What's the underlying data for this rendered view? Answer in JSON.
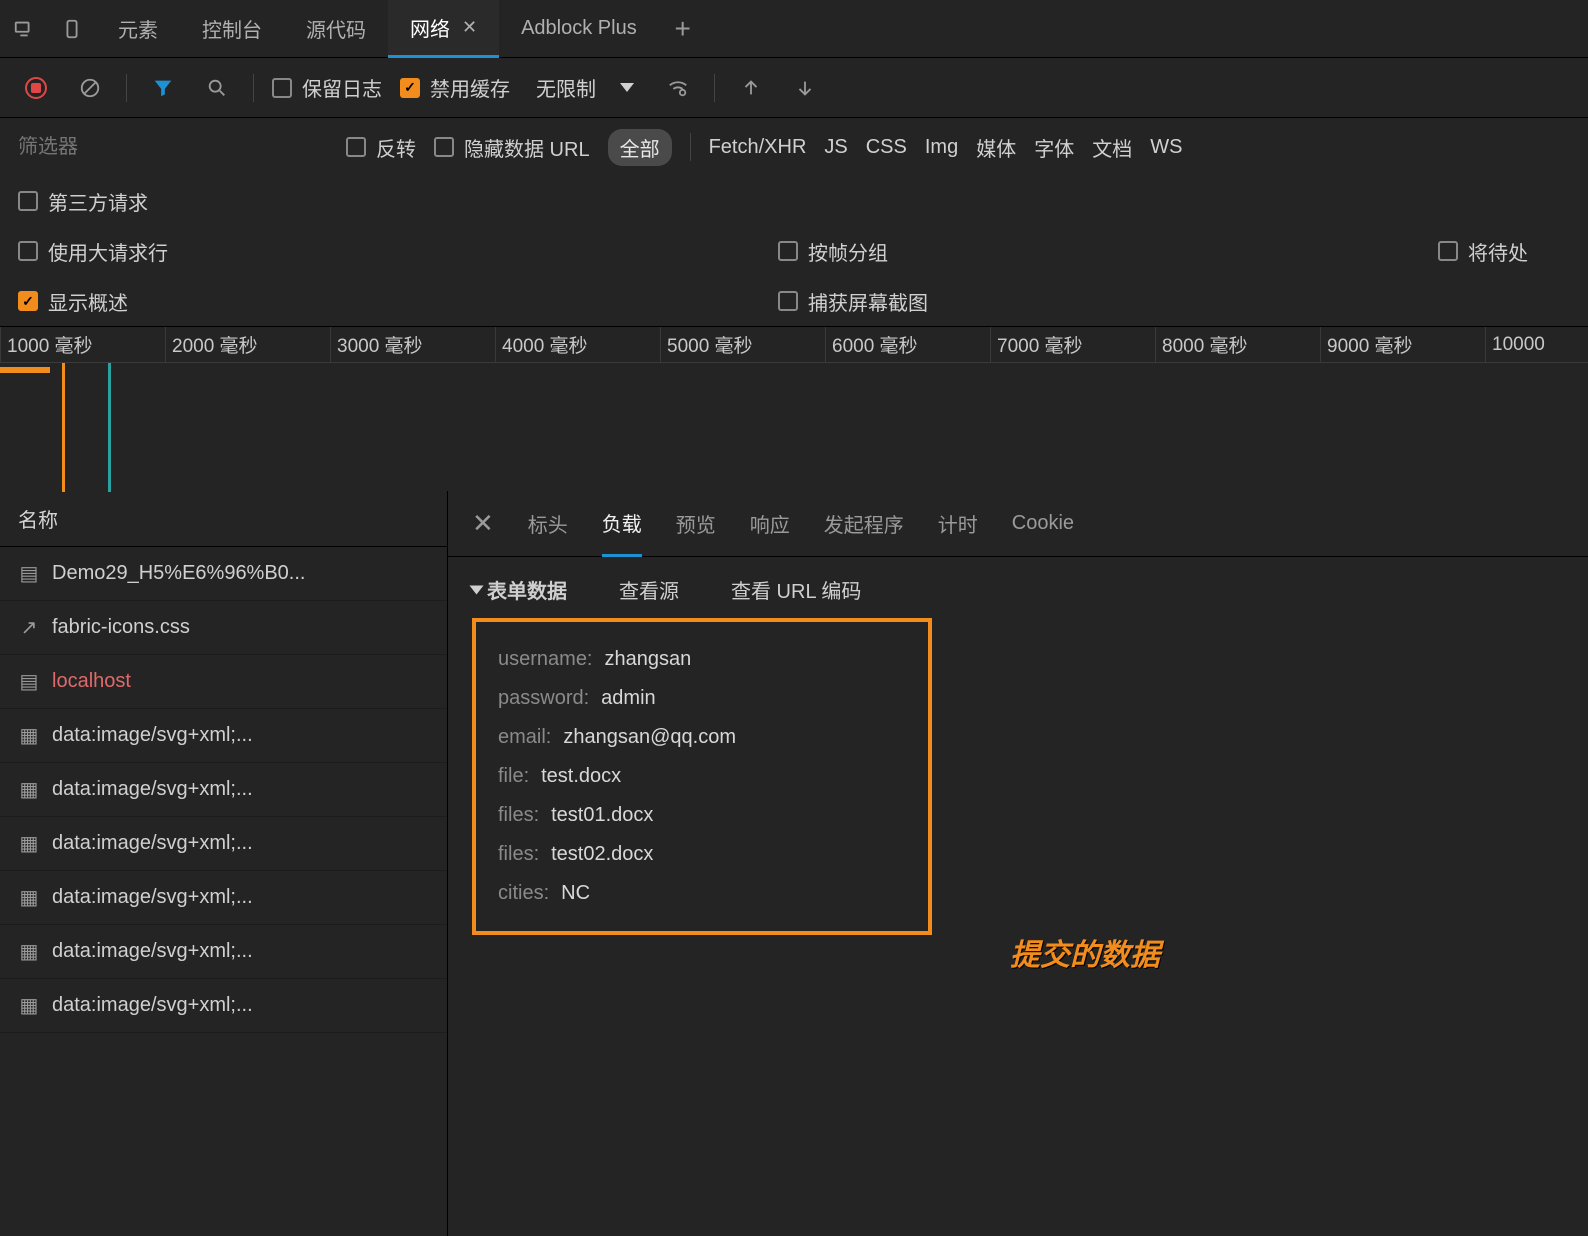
{
  "top_tabs": {
    "elements": "元素",
    "console": "控制台",
    "sources": "源代码",
    "network": "网络",
    "adblock": "Adblock Plus"
  },
  "toolbar": {
    "preserve_log": "保留日志",
    "disable_cache": "禁用缓存",
    "throttling": "无限制"
  },
  "filter": {
    "placeholder": "筛选器",
    "invert": "反转",
    "hide_data_url": "隐藏数据 URL",
    "all": "全部",
    "types": [
      "Fetch/XHR",
      "JS",
      "CSS",
      "Img",
      "媒体",
      "字体",
      "文档",
      "WS"
    ]
  },
  "options": {
    "third_party": "第三方请求",
    "large_rows": "使用大请求行",
    "group_by_frame": "按帧分组",
    "pending": "将待处",
    "show_overview": "显示概述",
    "screenshots": "捕获屏幕截图"
  },
  "timeline": {
    "ticks": [
      "1000 毫秒",
      "2000 毫秒",
      "3000 毫秒",
      "4000 毫秒",
      "5000 毫秒",
      "6000 毫秒",
      "7000 毫秒",
      "8000 毫秒",
      "9000 毫秒",
      "10000"
    ]
  },
  "requests": {
    "header": "名称",
    "items": [
      "Demo29_H5%E6%96%B0...",
      "fabric-icons.css",
      "localhost",
      "data:image/svg+xml;...",
      "data:image/svg+xml;...",
      "data:image/svg+xml;...",
      "data:image/svg+xml;...",
      "data:image/svg+xml;...",
      "data:image/svg+xml;..."
    ]
  },
  "detail_tabs": {
    "headers": "标头",
    "payload": "负载",
    "preview": "预览",
    "response": "响应",
    "initiator": "发起程序",
    "timing": "计时",
    "cookies": "Cookie"
  },
  "payload": {
    "section": "表单数据",
    "view_source": "查看源",
    "view_encoded": "查看 URL 编码",
    "rows": [
      {
        "key": "username:",
        "val": "zhangsan"
      },
      {
        "key": "password:",
        "val": "admin"
      },
      {
        "key": "email:",
        "val": "zhangsan@qq.com"
      },
      {
        "key": "file:",
        "val": "test.docx"
      },
      {
        "key": "files:",
        "val": "test01.docx"
      },
      {
        "key": "files:",
        "val": "test02.docx"
      },
      {
        "key": "cities:",
        "val": "NC"
      }
    ]
  },
  "annotation": "提交的数据"
}
